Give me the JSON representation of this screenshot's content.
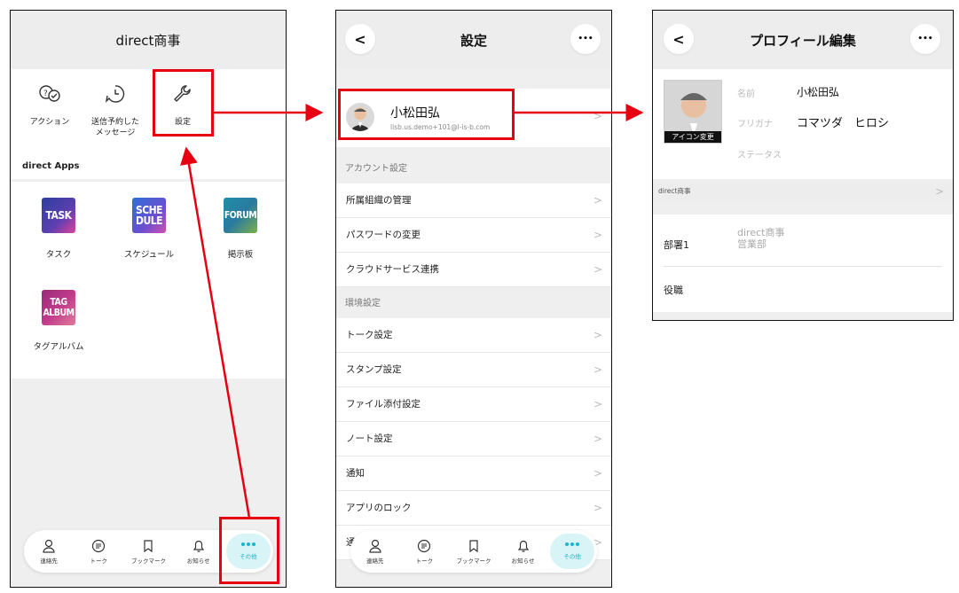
{
  "screen1": {
    "title": "direct商事",
    "menu": [
      {
        "label": "アクション",
        "icon": "action-icon"
      },
      {
        "label": "送信予約した\nメッセージ",
        "icon": "scheduled-message-icon"
      },
      {
        "label": "設定",
        "icon": "wrench-icon"
      }
    ],
    "apps_title": "direct Apps",
    "apps": [
      {
        "label": "タスク",
        "tile": "TASK",
        "color": "#2e3b8f"
      },
      {
        "label": "スケジュール",
        "tile": "SCHE\nDULE",
        "color": "#3a7fd0"
      },
      {
        "label": "掲示板",
        "tile": "FORUM",
        "color": "#2a8c9a"
      },
      {
        "label": "タグアルバム",
        "tile": "TAG\nALBUM",
        "color": "#9c2a8a"
      }
    ]
  },
  "tabs": [
    {
      "label": "連絡先",
      "icon": "contacts-icon"
    },
    {
      "label": "トーク",
      "icon": "talk-icon"
    },
    {
      "label": "ブックマーク",
      "icon": "bookmark-icon"
    },
    {
      "label": "お知らせ",
      "icon": "bell-icon"
    },
    {
      "label": "その他",
      "icon": "more-icon"
    }
  ],
  "screen2": {
    "title": "設定",
    "back": "<",
    "more": "•••",
    "profile": {
      "name": "小松田弘",
      "email": "lisb.us.demo+101@l-is-b.com"
    },
    "account_header": "アカウント設定",
    "account_rows": [
      "所属組織の管理",
      "パスワードの変更",
      "クラウドサービス連携"
    ],
    "env_header": "環境設定",
    "env_rows": [
      "トーク設定",
      "スタンプ設定",
      "ファイル添付設定",
      "ノート設定",
      "通知",
      "アプリのロック"
    ],
    "partial_row": "通"
  },
  "screen3": {
    "title": "プロフィール編集",
    "back": "<",
    "more": "•••",
    "avatar_caption": "アイコン変更",
    "fields": [
      {
        "label": "名前",
        "value": "小松田弘"
      },
      {
        "label": "フリガナ",
        "value": "コマツダ　ヒロシ"
      },
      {
        "label": "ステータス",
        "value": ""
      }
    ],
    "org": "direct商事",
    "dept_label": "部署1",
    "dept_value_1": "direct商事",
    "dept_value_2": "営業部",
    "position_label": "役職"
  },
  "chevron": ">",
  "colors": {
    "highlight": "#e60012",
    "accent": "#1cb5c9"
  }
}
